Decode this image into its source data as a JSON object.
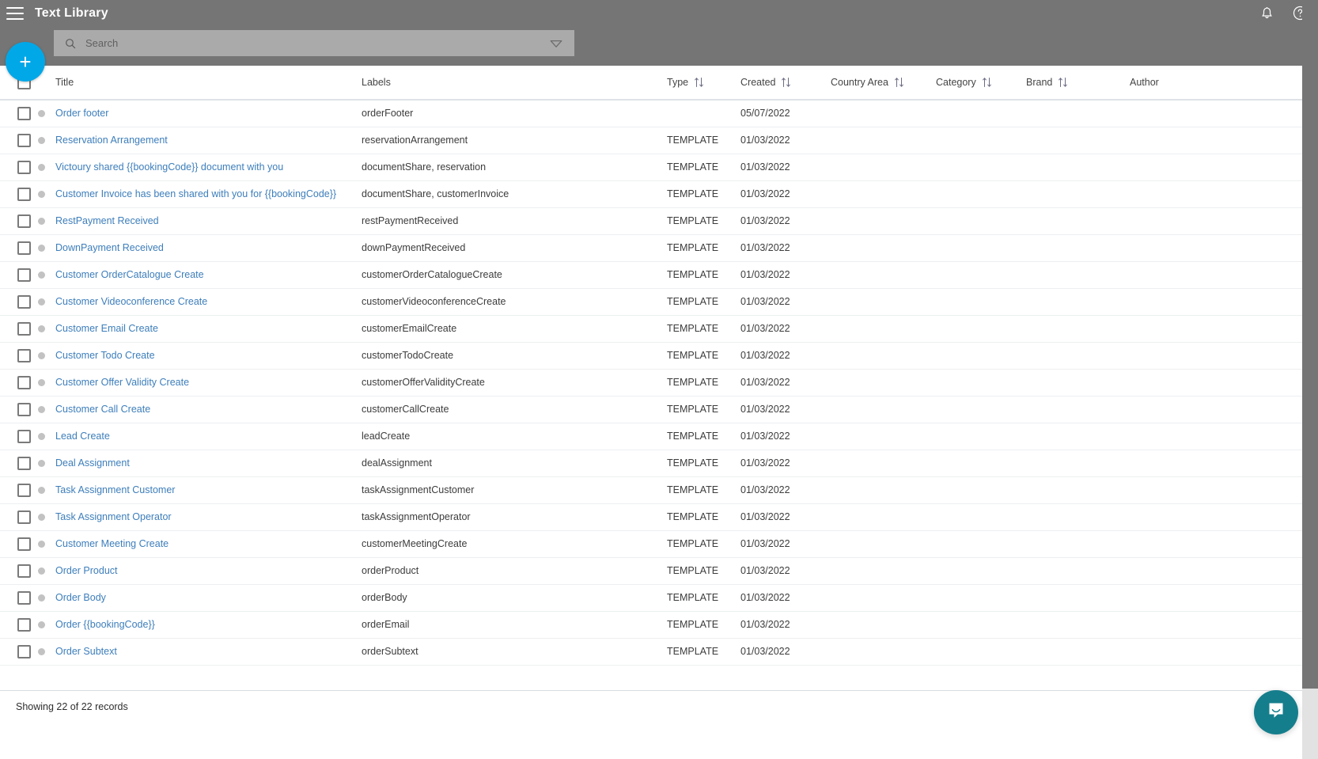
{
  "header": {
    "title": "Text Library",
    "menu_icon": "hamburger-icon",
    "notification_icon": "bell-icon",
    "help_icon": "help-circle-icon"
  },
  "search": {
    "placeholder": "Search",
    "value": "",
    "icon": "search-icon",
    "filter_icon": "filter-caret-icon"
  },
  "add_button": {
    "label": "+",
    "color": "#00A8E8"
  },
  "table": {
    "columns": [
      {
        "key": "title",
        "label": "Title",
        "sortable": false
      },
      {
        "key": "labels",
        "label": "Labels",
        "sortable": false
      },
      {
        "key": "type",
        "label": "Type",
        "sortable": true
      },
      {
        "key": "created",
        "label": "Created",
        "sortable": true
      },
      {
        "key": "country",
        "label": "Country Area",
        "sortable": true
      },
      {
        "key": "category",
        "label": "Category",
        "sortable": true
      },
      {
        "key": "brand",
        "label": "Brand",
        "sortable": true
      },
      {
        "key": "author",
        "label": "Author",
        "sortable": false
      }
    ],
    "rows": [
      {
        "title": "Order footer",
        "labels": "orderFooter",
        "type": "",
        "created": "05/07/2022",
        "country": "",
        "category": "",
        "brand": "",
        "author": ""
      },
      {
        "title": "Reservation Arrangement",
        "labels": "reservationArrangement",
        "type": "TEMPLATE",
        "created": "01/03/2022",
        "country": "",
        "category": "",
        "brand": "",
        "author": ""
      },
      {
        "title": "Victoury shared {{bookingCode}} document with you",
        "labels": "documentShare, reservation",
        "type": "TEMPLATE",
        "created": "01/03/2022",
        "country": "",
        "category": "",
        "brand": "",
        "author": ""
      },
      {
        "title": "Customer Invoice has been shared with you for {{bookingCode}}",
        "labels": "documentShare, customerInvoice",
        "type": "TEMPLATE",
        "created": "01/03/2022",
        "country": "",
        "category": "",
        "brand": "",
        "author": ""
      },
      {
        "title": "RestPayment Received",
        "labels": "restPaymentReceived",
        "type": "TEMPLATE",
        "created": "01/03/2022",
        "country": "",
        "category": "",
        "brand": "",
        "author": ""
      },
      {
        "title": "DownPayment Received",
        "labels": "downPaymentReceived",
        "type": "TEMPLATE",
        "created": "01/03/2022",
        "country": "",
        "category": "",
        "brand": "",
        "author": ""
      },
      {
        "title": "Customer OrderCatalogue Create",
        "labels": "customerOrderCatalogueCreate",
        "type": "TEMPLATE",
        "created": "01/03/2022",
        "country": "",
        "category": "",
        "brand": "",
        "author": ""
      },
      {
        "title": "Customer Videoconference Create",
        "labels": "customerVideoconferenceCreate",
        "type": "TEMPLATE",
        "created": "01/03/2022",
        "country": "",
        "category": "",
        "brand": "",
        "author": ""
      },
      {
        "title": "Customer Email Create",
        "labels": "customerEmailCreate",
        "type": "TEMPLATE",
        "created": "01/03/2022",
        "country": "",
        "category": "",
        "brand": "",
        "author": ""
      },
      {
        "title": "Customer Todo Create",
        "labels": "customerTodoCreate",
        "type": "TEMPLATE",
        "created": "01/03/2022",
        "country": "",
        "category": "",
        "brand": "",
        "author": ""
      },
      {
        "title": "Customer Offer Validity Create",
        "labels": "customerOfferValidityCreate",
        "type": "TEMPLATE",
        "created": "01/03/2022",
        "country": "",
        "category": "",
        "brand": "",
        "author": ""
      },
      {
        "title": "Customer Call Create",
        "labels": "customerCallCreate",
        "type": "TEMPLATE",
        "created": "01/03/2022",
        "country": "",
        "category": "",
        "brand": "",
        "author": ""
      },
      {
        "title": "Lead Create",
        "labels": "leadCreate",
        "type": "TEMPLATE",
        "created": "01/03/2022",
        "country": "",
        "category": "",
        "brand": "",
        "author": ""
      },
      {
        "title": "Deal Assignment",
        "labels": "dealAssignment",
        "type": "TEMPLATE",
        "created": "01/03/2022",
        "country": "",
        "category": "",
        "brand": "",
        "author": ""
      },
      {
        "title": "Task Assignment Customer",
        "labels": "taskAssignmentCustomer",
        "type": "TEMPLATE",
        "created": "01/03/2022",
        "country": "",
        "category": "",
        "brand": "",
        "author": ""
      },
      {
        "title": "Task Assignment Operator",
        "labels": "taskAssignmentOperator",
        "type": "TEMPLATE",
        "created": "01/03/2022",
        "country": "",
        "category": "",
        "brand": "",
        "author": ""
      },
      {
        "title": "Customer Meeting Create",
        "labels": "customerMeetingCreate",
        "type": "TEMPLATE",
        "created": "01/03/2022",
        "country": "",
        "category": "",
        "brand": "",
        "author": ""
      },
      {
        "title": "Order Product",
        "labels": "orderProduct",
        "type": "TEMPLATE",
        "created": "01/03/2022",
        "country": "",
        "category": "",
        "brand": "",
        "author": ""
      },
      {
        "title": "Order Body",
        "labels": "orderBody",
        "type": "TEMPLATE",
        "created": "01/03/2022",
        "country": "",
        "category": "",
        "brand": "",
        "author": ""
      },
      {
        "title": "Order {{bookingCode}}",
        "labels": "orderEmail",
        "type": "TEMPLATE",
        "created": "01/03/2022",
        "country": "",
        "category": "",
        "brand": "",
        "author": ""
      },
      {
        "title": "Order Subtext",
        "labels": "orderSubtext",
        "type": "TEMPLATE",
        "created": "01/03/2022",
        "country": "",
        "category": "",
        "brand": "",
        "author": ""
      }
    ]
  },
  "footer": {
    "records_text": "Showing 22 of 22 records"
  },
  "chat": {
    "icon": "chat-bubble-icon",
    "color": "#157E8C"
  },
  "colors": {
    "topbar": "#757575",
    "accent": "#00A8E8",
    "link": "#3d7ebb",
    "search_bg": "#aaaaaa"
  }
}
